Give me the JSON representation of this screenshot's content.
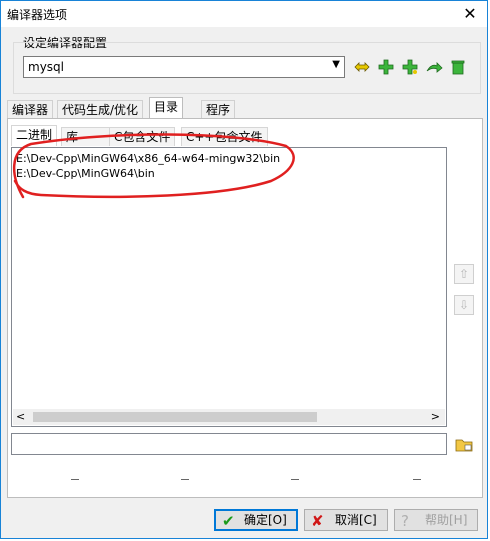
{
  "window": {
    "title": "编译器选项",
    "close_label": "✕"
  },
  "compiler_set": {
    "group_label": "设定编译器配置",
    "selected": "mysql"
  },
  "toolbar": {
    "icons": [
      "rename-icon",
      "add-icon",
      "add-copy-icon",
      "export-icon",
      "delete-icon"
    ]
  },
  "tabs": [
    {
      "label": "编译器",
      "active": false
    },
    {
      "label": "代码生成/优化",
      "active": false
    },
    {
      "label": "目录",
      "active": true
    },
    {
      "label": "程序",
      "active": false
    }
  ],
  "subtabs": [
    {
      "label": "二进制",
      "active": true
    },
    {
      "label": "库",
      "active": false
    },
    {
      "label": "C包含文件",
      "active": false
    },
    {
      "label": "C++包含文件",
      "active": false
    }
  ],
  "directories": [
    "E:\\Dev-Cpp\\MinGW64\\x86_64-w64-mingw32\\bin",
    "E:\\Dev-Cpp\\MinGW64\\bin"
  ],
  "path_input": {
    "value": ""
  },
  "buttons": {
    "ok": "确定[O]",
    "cancel": "取消[C]",
    "help": "帮助[H]"
  },
  "colors": {
    "annotation": "#e02020",
    "accent": "#0078d7"
  }
}
